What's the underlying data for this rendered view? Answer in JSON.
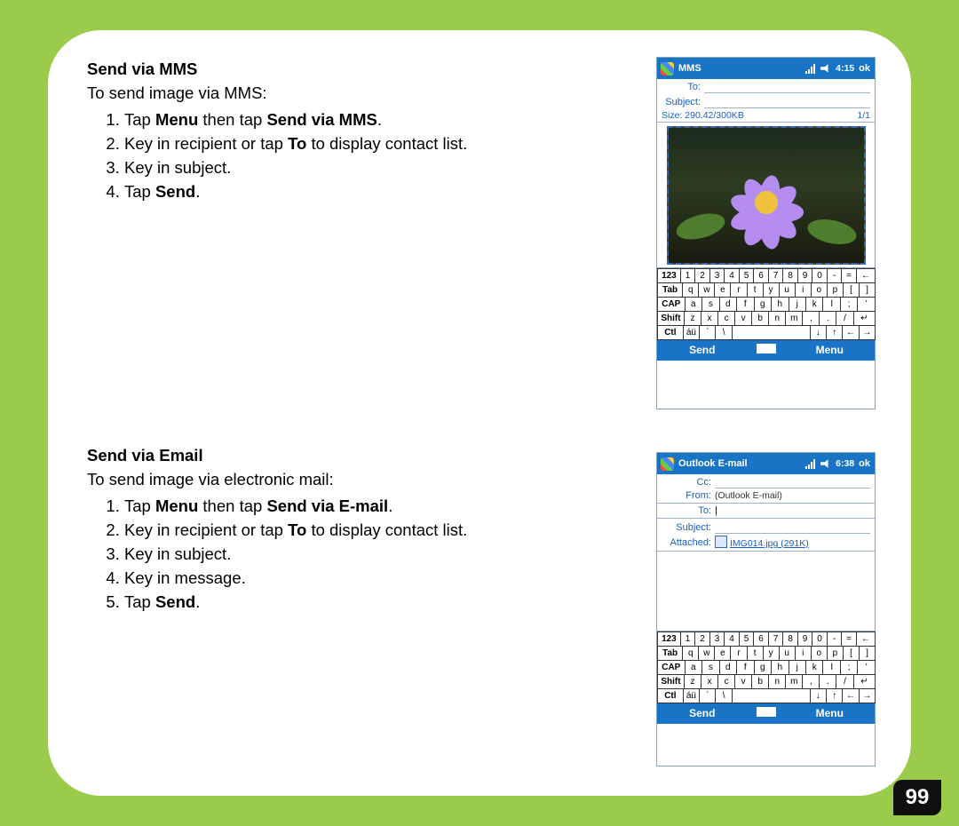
{
  "page_number": "99",
  "section1": {
    "heading": "Send via MMS",
    "intro": "To send image via MMS:",
    "steps": {
      "s1a": "Tap ",
      "s1b": "Menu",
      "s1c": " then tap ",
      "s1d": "Send via MMS",
      "s1e": ".",
      "s2a": "Key in recipient or tap ",
      "s2b": "To",
      "s2c": " to display contact list.",
      "s3": "Key in subject.",
      "s4a": "Tap ",
      "s4b": "Send",
      "s4c": "."
    }
  },
  "section2": {
    "heading": "Send via Email",
    "intro": "To send image via electronic mail:",
    "steps": {
      "s1a": "Tap ",
      "s1b": "Menu",
      "s1c": " then tap ",
      "s1d": "Send via E-mail",
      "s1e": ".",
      "s2a": "Key in recipient or tap ",
      "s2b": "To",
      "s2c": " to display contact list.",
      "s3": "Key in subject.",
      "s4": "Key in message.",
      "s5a": "Tap ",
      "s5b": "Send",
      "s5c": "."
    }
  },
  "shot_mms": {
    "title": "MMS",
    "time": "4:15",
    "ok": "ok",
    "to_label": "To:",
    "subject_label": "Subject:",
    "size_text": "Size: 290.42/300KB",
    "slide_counter": "1/1",
    "soft_left": "Send",
    "soft_right": "Menu"
  },
  "shot_email": {
    "title": "Outlook E-mail",
    "time": "6:38",
    "ok": "ok",
    "cc_label": "Cc:",
    "from_label": "From:",
    "from_value": "(Outlook E-mail)",
    "to_label": "To:",
    "to_value": "|",
    "subject_label": "Subject:",
    "attached_label": "Attached:",
    "attached_value": "IMG014.jpg (291K)",
    "soft_left": "Send",
    "soft_right": "Menu"
  },
  "keyboard": {
    "r1_mod": "123",
    "r1": [
      "1",
      "2",
      "3",
      "4",
      "5",
      "6",
      "7",
      "8",
      "9",
      "0",
      "-",
      "="
    ],
    "r2_mod": "Tab",
    "r2": [
      "q",
      "w",
      "e",
      "r",
      "t",
      "y",
      "u",
      "i",
      "o",
      "p",
      "[",
      "]"
    ],
    "r3_mod": "CAP",
    "r3": [
      "a",
      "s",
      "d",
      "f",
      "g",
      "h",
      "j",
      "k",
      "l",
      ";",
      "'"
    ],
    "r4_mod": "Shift",
    "r4": [
      "z",
      "x",
      "c",
      "v",
      "b",
      "n",
      "m",
      ",",
      ".",
      "/"
    ],
    "r5_mod": "Ctl",
    "r5": [
      "áü",
      "`",
      "\\"
    ]
  }
}
